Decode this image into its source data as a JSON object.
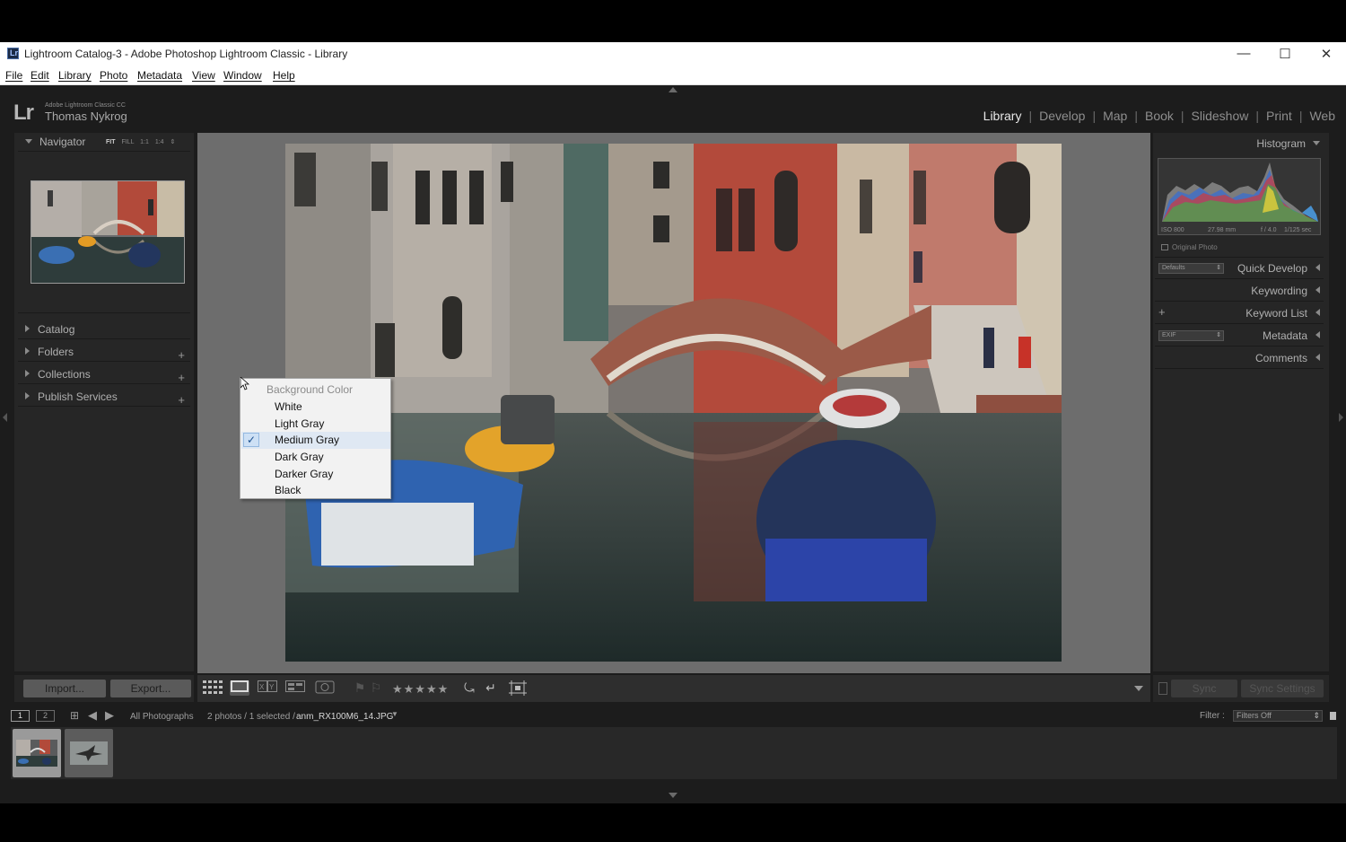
{
  "window": {
    "title": "Lightroom Catalog-3 - Adobe Photoshop Lightroom Classic - Library",
    "icon_letter": "Lr",
    "controls": {
      "minimize": "—",
      "maximize": "☐",
      "close": "✕"
    }
  },
  "menubar": [
    "File",
    "Edit",
    "Library",
    "Photo",
    "Metadata",
    "View",
    "Window",
    "Help"
  ],
  "identity": {
    "logo": "Lr",
    "product": "Adobe Lightroom Classic CC",
    "user": "Thomas Nykrog"
  },
  "modules": [
    {
      "label": "Library",
      "active": true
    },
    {
      "label": "Develop",
      "active": false
    },
    {
      "label": "Map",
      "active": false
    },
    {
      "label": "Book",
      "active": false
    },
    {
      "label": "Slideshow",
      "active": false
    },
    {
      "label": "Print",
      "active": false
    },
    {
      "label": "Web",
      "active": false
    }
  ],
  "left_panel": {
    "navigator": {
      "label": "Navigator",
      "zoom_fit": "FIT",
      "zoom_fill": "FILL",
      "zoom_1_1": "1:1",
      "zoom_1_4": "1:4"
    },
    "sections": [
      {
        "label": "Catalog",
        "has_plus": false
      },
      {
        "label": "Folders",
        "has_plus": true
      },
      {
        "label": "Collections",
        "has_plus": true
      },
      {
        "label": "Publish Services",
        "has_plus": true
      }
    ],
    "import_label": "Import...",
    "export_label": "Export..."
  },
  "context_menu": {
    "header": "Background Color",
    "items": [
      {
        "label": "White",
        "checked": false
      },
      {
        "label": "Light Gray",
        "checked": false
      },
      {
        "label": "Medium Gray",
        "checked": true
      },
      {
        "label": "Dark Gray",
        "checked": false
      },
      {
        "label": "Darker Gray",
        "checked": false
      },
      {
        "label": "Black",
        "checked": false
      }
    ],
    "check_glyph": "✓"
  },
  "right_panel": {
    "histogram": {
      "label": "Histogram",
      "iso": "ISO 800",
      "focal": "27.98 mm",
      "aperture": "f / 4.0",
      "shutter": "1/125 sec",
      "original_photo": "Original Photo"
    },
    "quick_develop": {
      "label": "Quick Develop",
      "preset": "Defaults"
    },
    "keywording": {
      "label": "Keywording"
    },
    "keyword_list": {
      "label": "Keyword List",
      "plus": "+"
    },
    "metadata": {
      "label": "Metadata",
      "preset": "EXIF"
    },
    "comments": {
      "label": "Comments"
    },
    "sync_label": "Sync",
    "sync_settings_label": "Sync Settings"
  },
  "toolbar": {
    "stars": "★★★★★"
  },
  "filmstrip_bar": {
    "screen1": "1",
    "screen2": "2",
    "source": "All Photographs",
    "info": "2 photos / 1 selected /",
    "filename": "anm_RX100M6_14.JPG",
    "filter_label": "Filter :",
    "filter_value": "Filters Off"
  },
  "colors": {
    "panel_bg": "#262626",
    "loupe_bg": "#6d6d6d",
    "active_module": "#e8e8e8"
  }
}
